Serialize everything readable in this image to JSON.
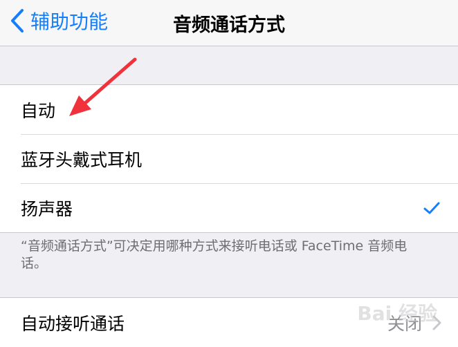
{
  "nav": {
    "back_label": "辅助功能",
    "title": "音频通话方式"
  },
  "options": [
    {
      "label": "自动",
      "selected": false
    },
    {
      "label": "蓝牙头戴式耳机",
      "selected": false
    },
    {
      "label": "扬声器",
      "selected": true
    }
  ],
  "footer_text": "“音频通话方式”可决定用哪种方式来接听电话或 FaceTime 音频电话。",
  "auto_answer": {
    "label": "自动接听通话",
    "value": "关闭"
  },
  "watermark": "Bai 经验",
  "colors": {
    "accent": "#157efb",
    "annotation_arrow": "#f0323c"
  }
}
